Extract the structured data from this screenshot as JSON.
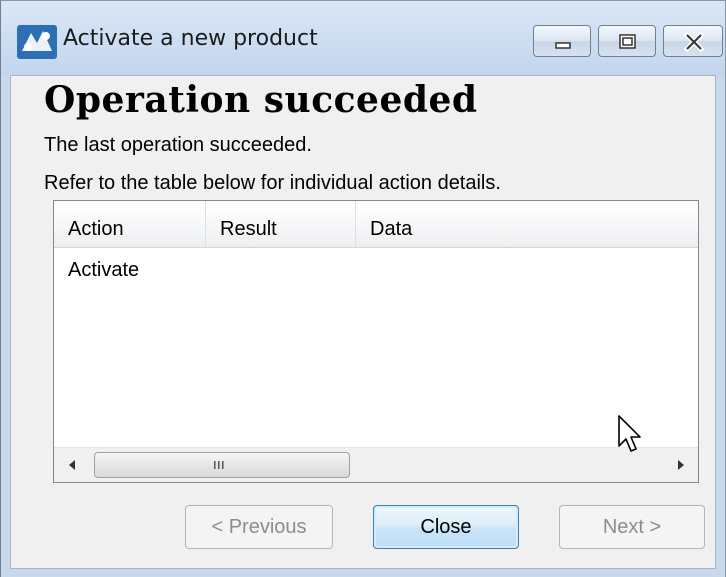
{
  "window": {
    "title": "Activate a new product"
  },
  "page": {
    "heading": "Operation succeeded",
    "message": "The last operation succeeded.",
    "instructions": "Refer to the table below for individual action details."
  },
  "table": {
    "columns": [
      "Action",
      "Result",
      "Data"
    ],
    "rows": [
      {
        "action": "Activate",
        "result": "",
        "data": ""
      }
    ]
  },
  "buttons": {
    "previous": "< Previous",
    "close": "Close",
    "next": "Next >"
  },
  "colors": {
    "title_bar": "#cfdff2",
    "default_button_border": "#3c7fb1",
    "disabled_text": "#8d8d8d"
  }
}
